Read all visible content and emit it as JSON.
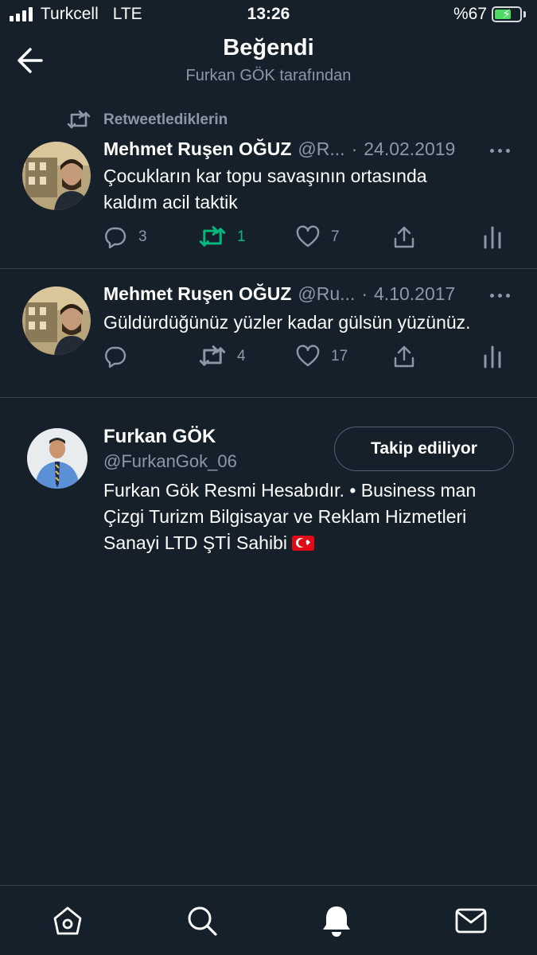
{
  "status_bar": {
    "carrier": "Turkcell",
    "network": "LTE",
    "time": "13:26",
    "battery_text": "%67",
    "battery_level": 0.67
  },
  "header": {
    "title": "Beğendi",
    "subtitle": "Furkan GÖK tarafından"
  },
  "retweet_context": "Retweetlediklerin",
  "tweets": [
    {
      "name": "Mehmet Ruşen OĞUZ",
      "handle": "@R...",
      "date": "24.02.2019",
      "text_line1": "Çocukların kar topu savaşının ortasında",
      "text_line2": "kaldım acil taktik",
      "replies": "3",
      "retweets": "1",
      "likes": "7",
      "retweeted": true
    },
    {
      "name": "Mehmet Ruşen OĞUZ",
      "handle": "@Ru...",
      "date": "4.10.2017",
      "text_line1": "Güldürdüğünüz yüzler kadar gülsün yüzünüz.",
      "replies": "",
      "retweets": "4",
      "likes": "17",
      "retweeted": false
    }
  ],
  "user": {
    "name": "Furkan GÖK",
    "handle": "@FurkanGok_06",
    "follow_label": "Takip ediliyor",
    "bio_line1": "Furkan Gök Resmi Hesabıdır. • Business man",
    "bio_line2": "Çizgi Turizm Bilgisayar ve Reklam Hizmetleri",
    "bio_line3": "Sanayi LTD ŞTİ Sahibi"
  },
  "colors": {
    "background": "#15202b",
    "secondary_text": "#8b98a5",
    "divider": "#38444d",
    "retweet_green": "#00ba7c",
    "battery_green": "#4cd964"
  },
  "nav": {
    "items": [
      "home-icon",
      "search-icon",
      "notifications-icon",
      "messages-icon"
    ],
    "active": "notifications-icon"
  }
}
